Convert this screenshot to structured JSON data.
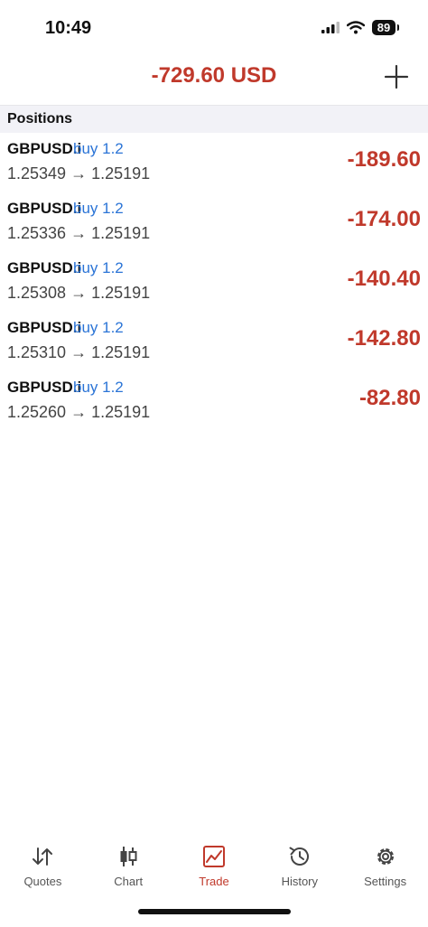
{
  "status_bar": {
    "time": "10:49",
    "battery": "89"
  },
  "header": {
    "balance": "-729.60 USD"
  },
  "section": {
    "title": "Positions"
  },
  "positions": [
    {
      "symbol": "GBPUSD.i",
      "side": "buy 1.2",
      "prices": "1.25349 → 1.25191",
      "profit": "-189.60"
    },
    {
      "symbol": "GBPUSD.i",
      "side": "buy 1.2",
      "prices": "1.25336 → 1.25191",
      "profit": "-174.00"
    },
    {
      "symbol": "GBPUSD.i",
      "side": "buy 1.2",
      "prices": "1.25308 → 1.25191",
      "profit": "-140.40"
    },
    {
      "symbol": "GBPUSD.i",
      "side": "buy 1.2",
      "prices": "1.25310 → 1.25191",
      "profit": "-142.80"
    },
    {
      "symbol": "GBPUSD.i",
      "side": "buy 1.2",
      "prices": "1.25260 → 1.25191",
      "profit": "-82.80"
    }
  ],
  "tabs": [
    {
      "label": "Quotes",
      "icon": "quotes-icon"
    },
    {
      "label": "Chart",
      "icon": "chart-icon"
    },
    {
      "label": "Trade",
      "icon": "trade-icon",
      "active": true
    },
    {
      "label": "History",
      "icon": "history-icon"
    },
    {
      "label": "Settings",
      "icon": "settings-icon"
    }
  ],
  "colors": {
    "loss": "#c0392b",
    "buy": "#2b74d6",
    "active_tab": "#c0392b"
  }
}
